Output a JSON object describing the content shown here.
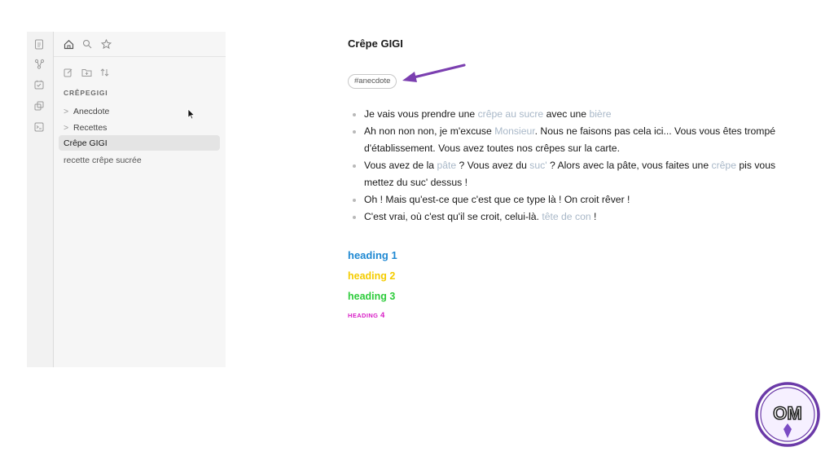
{
  "ribbon": {
    "icons": [
      "files-icon",
      "graph-icon",
      "calendar-icon",
      "copy-icon",
      "terminal-icon"
    ]
  },
  "sidebar": {
    "top_icons": [
      "home-icon",
      "search-icon",
      "star-icon"
    ],
    "action_icons": [
      "new-note-icon",
      "new-folder-icon",
      "sort-icon"
    ],
    "vault_name": "CRÊPEGIGI",
    "items": [
      {
        "label": "Anecdote",
        "chevron": ">"
      },
      {
        "label": "Recettes",
        "chevron": ">"
      },
      {
        "label": "Crêpe GIGI"
      },
      {
        "label": "recette crêpe sucrée"
      }
    ]
  },
  "note": {
    "title": "Crêpe GIGI",
    "tag": "#anecdote",
    "arrow_color": "#7b3fb0",
    "bullets": [
      {
        "t1": "Je vais vous prendre une ",
        "l1": "crêpe au sucre",
        "t2": " avec une ",
        "l2": "bière"
      },
      {
        "t1": "Ah non non non, je m'excuse ",
        "l1": "Monsieur",
        "t2": ". Nous ne faisons pas cela ici... Vous vous êtes trompé d'établissement. Vous avez toutes nos crêpes sur la carte."
      },
      {
        "t1": "Vous avez de la ",
        "l1": "pâte",
        "t2": " ? Vous avez du ",
        "l2": "suc'",
        "t3": " ? Alors avec la pâte, vous faites une ",
        "l3": "crêpe",
        "t4": " pis vous mettez du suc' dessus !"
      },
      {
        "t1": "Oh ! Mais qu'est-ce que c'est que ce type là ! On croit rêver !"
      },
      {
        "t1": "C'est vrai, où c'est qu'il se croit, celui-là. ",
        "l1": "tête de con",
        "t2": " !"
      }
    ],
    "headings": {
      "h1": "heading 1",
      "h2": "heading 2",
      "h3": "heading 3",
      "h4_word": "HEADING",
      "h4_num": "4"
    },
    "heading_colors": {
      "h1": "#1e88d2",
      "h2": "#f4cc00",
      "h3": "#2ecc3c",
      "h4": "#d81cc6"
    },
    "link_color": "#a9b8c8"
  },
  "logo": {
    "text": "OM",
    "color": "#6b3aa8"
  }
}
